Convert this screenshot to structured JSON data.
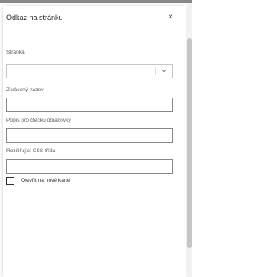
{
  "dialog": {
    "title": "Odkaz na stránku",
    "close_glyph": "×"
  },
  "fields": {
    "page": {
      "label": "Stránka",
      "value": ""
    },
    "short_name": {
      "label": "Zkrácený název",
      "value": ""
    },
    "screen_reader": {
      "label": "Popis pro čtečku obrazovky",
      "value": ""
    },
    "css_class": {
      "label": "Rozšiřující CSS třída",
      "value": ""
    }
  },
  "new_tab": {
    "label": "Otevřít na nové kartě",
    "checked": false
  },
  "icons": {
    "close": "close-icon",
    "dropdown": "chevron-down-icon"
  }
}
